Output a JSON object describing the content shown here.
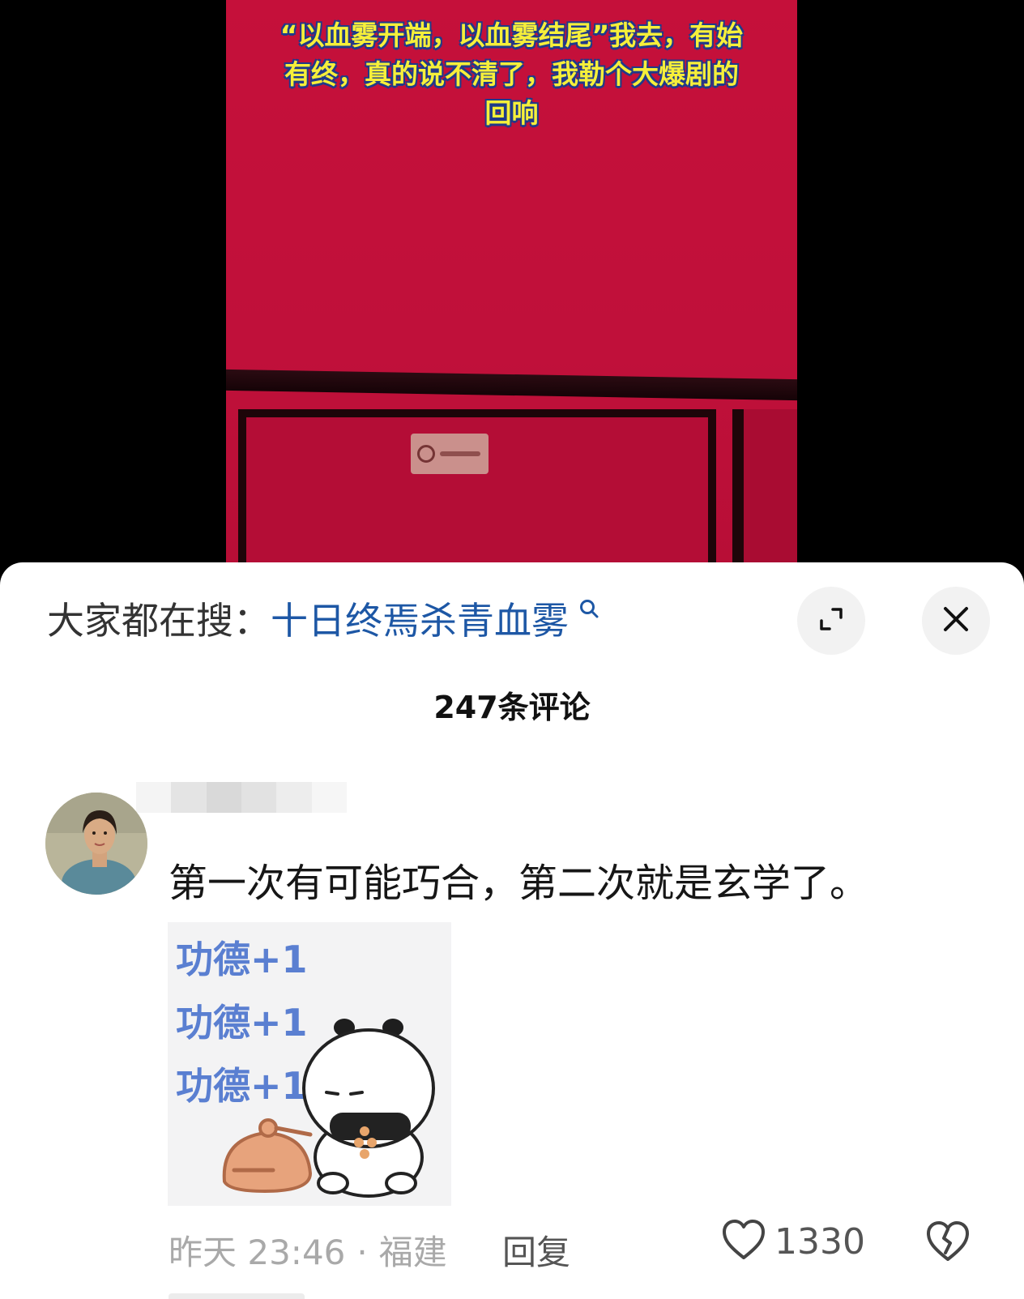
{
  "video": {
    "caption_lines": [
      "“以血雾开端，以血雾结尾”我去，有始",
      "有终，真的说不清了，我勒个大爆剧的",
      "回响"
    ]
  },
  "search_bar": {
    "label": "大家都在搜：",
    "term": "十日终焉杀青血雾",
    "icon": "search-icon"
  },
  "comments_header": {
    "count_title": "247条评论"
  },
  "comment": {
    "text": "第一次有可能巧合，第二次就是玄学了。",
    "sticker_text": [
      "功德+1",
      "功德+1",
      "功德+1"
    ],
    "time": "昨天 23:46",
    "location": "福建",
    "separator": "·",
    "reply_label": "回复",
    "like_count": "1330"
  },
  "colors": {
    "accent_link": "#1d57a5",
    "video_red": "#c5103a",
    "caption_yellow": "#f6ef3a"
  }
}
